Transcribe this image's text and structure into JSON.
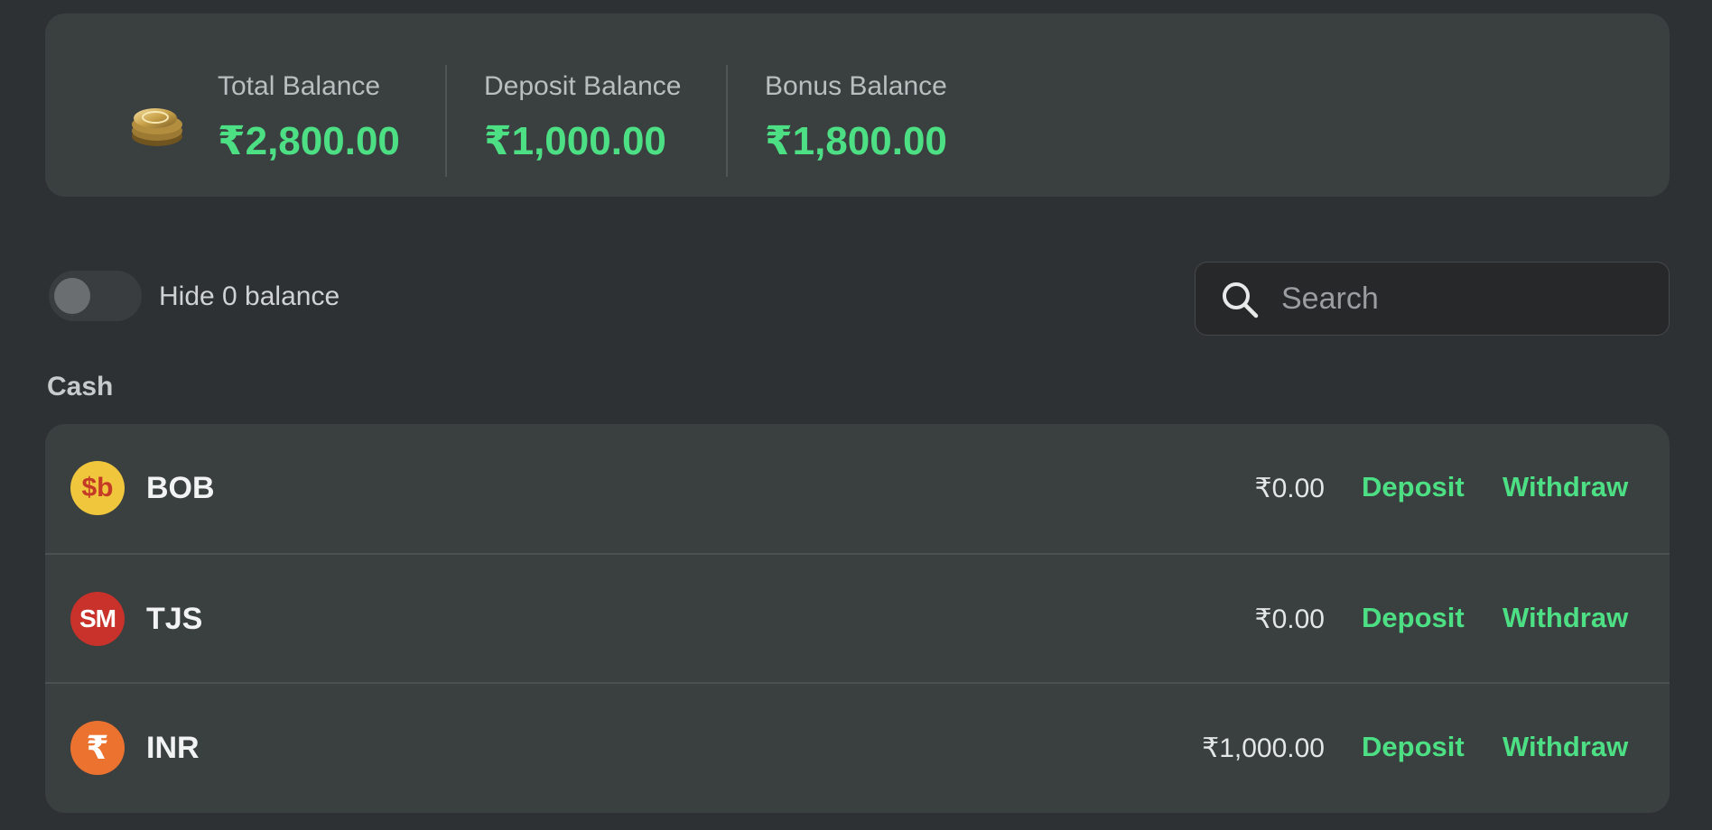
{
  "summary": {
    "total": {
      "label": "Total Balance",
      "value": "₹2,800.00"
    },
    "deposit": {
      "label": "Deposit Balance",
      "value": "₹1,000.00"
    },
    "bonus": {
      "label": "Bonus Balance",
      "value": "₹1,800.00"
    },
    "icon": "coin-stack-icon"
  },
  "controls": {
    "hide_zero_label": "Hide 0 balance",
    "hide_zero_enabled": false,
    "search_placeholder": "Search",
    "search_value": ""
  },
  "section_title": "Cash",
  "currencies": [
    {
      "code": "BOB",
      "icon_text": "$b",
      "amount": "₹0.00",
      "deposit_label": "Deposit",
      "withdraw_label": "Withdraw"
    },
    {
      "code": "TJS",
      "icon_text": "SM",
      "amount": "₹0.00",
      "deposit_label": "Deposit",
      "withdraw_label": "Withdraw"
    },
    {
      "code": "INR",
      "icon_text": "₹",
      "amount": "₹1,000.00",
      "deposit_label": "Deposit",
      "withdraw_label": "Withdraw"
    }
  ],
  "colors": {
    "background": "#2e3133",
    "card": "#3a3f40",
    "accent_green": "#4ddf84",
    "bob_icon": "#f0c73c",
    "tjs_icon": "#c8322a",
    "inr_icon": "#ec7230"
  }
}
